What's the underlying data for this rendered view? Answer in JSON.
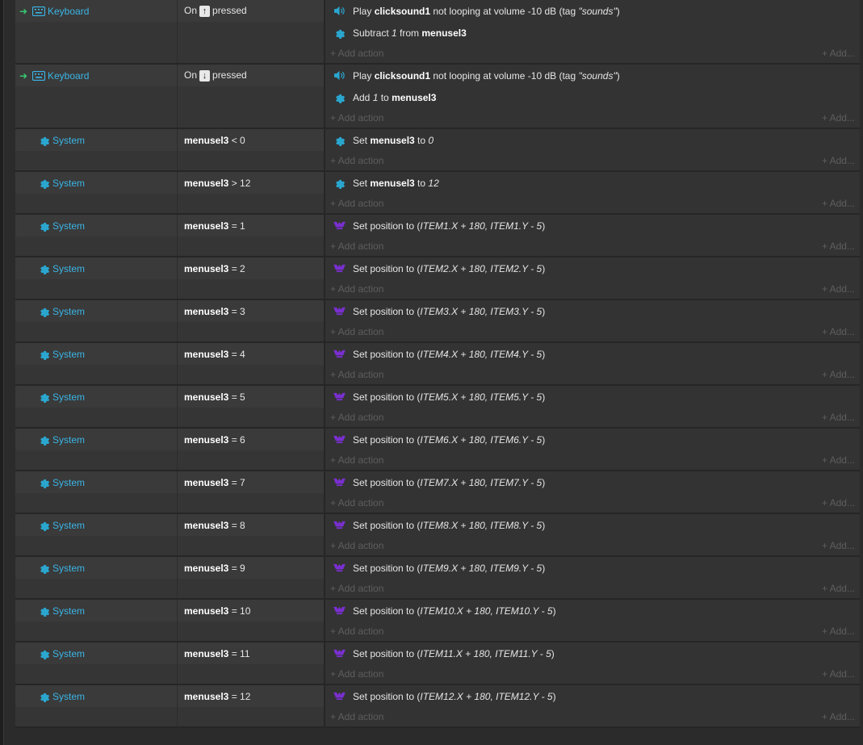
{
  "colors": {
    "background": "#2b2b2b",
    "object_name": "#3ab5e6",
    "trigger_arrow": "#37c871",
    "system_icon": "#2aa6cf",
    "sprite_icon": "#7a2fd0",
    "add_text": "#5e5e5e"
  },
  "labels": {
    "add_action": "+ Add action",
    "add_more": "+ Add..."
  },
  "events": [
    {
      "trigger": true,
      "object": "Keyboard",
      "object_icon": "keyboard-icon",
      "condition": {
        "prefix": "On",
        "key": "↑",
        "suffix": "pressed"
      },
      "actions": [
        {
          "icon": "speaker-icon",
          "parts": [
            {
              "t": "Play "
            },
            {
              "b": "clicksound1"
            },
            {
              "t": " not looping at volume -10 dB (tag "
            },
            {
              "i": "\"sounds\""
            },
            {
              "t": ")"
            }
          ]
        },
        {
          "icon": "system-gear-icon",
          "parts": [
            {
              "t": "Subtract "
            },
            {
              "i": "1"
            },
            {
              "t": " from "
            },
            {
              "b": "menusel3"
            }
          ]
        }
      ]
    },
    {
      "trigger": true,
      "object": "Keyboard",
      "object_icon": "keyboard-icon",
      "condition": {
        "prefix": "On",
        "key": "↓",
        "suffix": "pressed"
      },
      "actions": [
        {
          "icon": "speaker-icon",
          "parts": [
            {
              "t": "Play "
            },
            {
              "b": "clicksound1"
            },
            {
              "t": " not looping at volume -10 dB (tag "
            },
            {
              "i": "\"sounds\""
            },
            {
              "t": ")"
            }
          ]
        },
        {
          "icon": "system-gear-icon",
          "parts": [
            {
              "t": "Add "
            },
            {
              "i": "1"
            },
            {
              "t": " to "
            },
            {
              "b": "menusel3"
            }
          ]
        }
      ]
    },
    {
      "trigger": false,
      "object": "System",
      "object_icon": "system-gear-icon",
      "condition": {
        "var": "menusel3",
        "op": "< 0"
      },
      "actions": [
        {
          "icon": "system-gear-icon",
          "parts": [
            {
              "t": "Set "
            },
            {
              "b": "menusel3"
            },
            {
              "t": " to "
            },
            {
              "i": "0"
            }
          ]
        }
      ]
    },
    {
      "trigger": false,
      "object": "System",
      "object_icon": "system-gear-icon",
      "condition": {
        "var": "menusel3",
        "op": "> 12"
      },
      "actions": [
        {
          "icon": "system-gear-icon",
          "parts": [
            {
              "t": "Set "
            },
            {
              "b": "menusel3"
            },
            {
              "t": " to "
            },
            {
              "i": "12"
            }
          ]
        }
      ]
    },
    {
      "trigger": false,
      "object": "System",
      "object_icon": "system-gear-icon",
      "condition": {
        "var": "menusel3",
        "op": "= 1"
      },
      "actions": [
        {
          "icon": "sprite-icon",
          "parts": [
            {
              "t": "Set position to ("
            },
            {
              "i": "ITEM1.X + 180, ITEM1.Y - 5"
            },
            {
              "t": ")"
            }
          ]
        }
      ]
    },
    {
      "trigger": false,
      "object": "System",
      "object_icon": "system-gear-icon",
      "condition": {
        "var": "menusel3",
        "op": "= 2"
      },
      "actions": [
        {
          "icon": "sprite-icon",
          "parts": [
            {
              "t": "Set position to ("
            },
            {
              "i": "ITEM2.X + 180, ITEM2.Y - 5"
            },
            {
              "t": ")"
            }
          ]
        }
      ]
    },
    {
      "trigger": false,
      "object": "System",
      "object_icon": "system-gear-icon",
      "condition": {
        "var": "menusel3",
        "op": "= 3"
      },
      "actions": [
        {
          "icon": "sprite-icon",
          "parts": [
            {
              "t": "Set position to ("
            },
            {
              "i": "ITEM3.X + 180, ITEM3.Y - 5"
            },
            {
              "t": ")"
            }
          ]
        }
      ]
    },
    {
      "trigger": false,
      "object": "System",
      "object_icon": "system-gear-icon",
      "condition": {
        "var": "menusel3",
        "op": "= 4"
      },
      "actions": [
        {
          "icon": "sprite-icon",
          "parts": [
            {
              "t": "Set position to ("
            },
            {
              "i": "ITEM4.X + 180, ITEM4.Y - 5"
            },
            {
              "t": ")"
            }
          ]
        }
      ]
    },
    {
      "trigger": false,
      "object": "System",
      "object_icon": "system-gear-icon",
      "condition": {
        "var": "menusel3",
        "op": "= 5"
      },
      "actions": [
        {
          "icon": "sprite-icon",
          "parts": [
            {
              "t": "Set position to ("
            },
            {
              "i": "ITEM5.X + 180, ITEM5.Y - 5"
            },
            {
              "t": ")"
            }
          ]
        }
      ]
    },
    {
      "trigger": false,
      "object": "System",
      "object_icon": "system-gear-icon",
      "condition": {
        "var": "menusel3",
        "op": "= 6"
      },
      "actions": [
        {
          "icon": "sprite-icon",
          "parts": [
            {
              "t": "Set position to ("
            },
            {
              "i": "ITEM6.X + 180, ITEM6.Y - 5"
            },
            {
              "t": ")"
            }
          ]
        }
      ]
    },
    {
      "trigger": false,
      "object": "System",
      "object_icon": "system-gear-icon",
      "condition": {
        "var": "menusel3",
        "op": "= 7"
      },
      "actions": [
        {
          "icon": "sprite-icon",
          "parts": [
            {
              "t": "Set position to ("
            },
            {
              "i": "ITEM7.X + 180, ITEM7.Y - 5"
            },
            {
              "t": ")"
            }
          ]
        }
      ]
    },
    {
      "trigger": false,
      "object": "System",
      "object_icon": "system-gear-icon",
      "condition": {
        "var": "menusel3",
        "op": "= 8"
      },
      "actions": [
        {
          "icon": "sprite-icon",
          "parts": [
            {
              "t": "Set position to ("
            },
            {
              "i": "ITEM8.X + 180, ITEM8.Y - 5"
            },
            {
              "t": ")"
            }
          ]
        }
      ]
    },
    {
      "trigger": false,
      "object": "System",
      "object_icon": "system-gear-icon",
      "condition": {
        "var": "menusel3",
        "op": "= 9"
      },
      "actions": [
        {
          "icon": "sprite-icon",
          "parts": [
            {
              "t": "Set position to ("
            },
            {
              "i": "ITEM9.X + 180, ITEM9.Y - 5"
            },
            {
              "t": ")"
            }
          ]
        }
      ]
    },
    {
      "trigger": false,
      "object": "System",
      "object_icon": "system-gear-icon",
      "condition": {
        "var": "menusel3",
        "op": "= 10"
      },
      "actions": [
        {
          "icon": "sprite-icon",
          "parts": [
            {
              "t": "Set position to ("
            },
            {
              "i": "ITEM10.X + 180, ITEM10.Y - 5"
            },
            {
              "t": ")"
            }
          ]
        }
      ]
    },
    {
      "trigger": false,
      "object": "System",
      "object_icon": "system-gear-icon",
      "condition": {
        "var": "menusel3",
        "op": "= 11"
      },
      "actions": [
        {
          "icon": "sprite-icon",
          "parts": [
            {
              "t": "Set position to ("
            },
            {
              "i": "ITEM11.X + 180, ITEM11.Y - 5"
            },
            {
              "t": ")"
            }
          ]
        }
      ]
    },
    {
      "trigger": false,
      "object": "System",
      "object_icon": "system-gear-icon",
      "condition": {
        "var": "menusel3",
        "op": "= 12"
      },
      "actions": [
        {
          "icon": "sprite-icon",
          "parts": [
            {
              "t": "Set position to ("
            },
            {
              "i": "ITEM12.X + 180, ITEM12.Y - 5"
            },
            {
              "t": ")"
            }
          ]
        }
      ]
    }
  ]
}
